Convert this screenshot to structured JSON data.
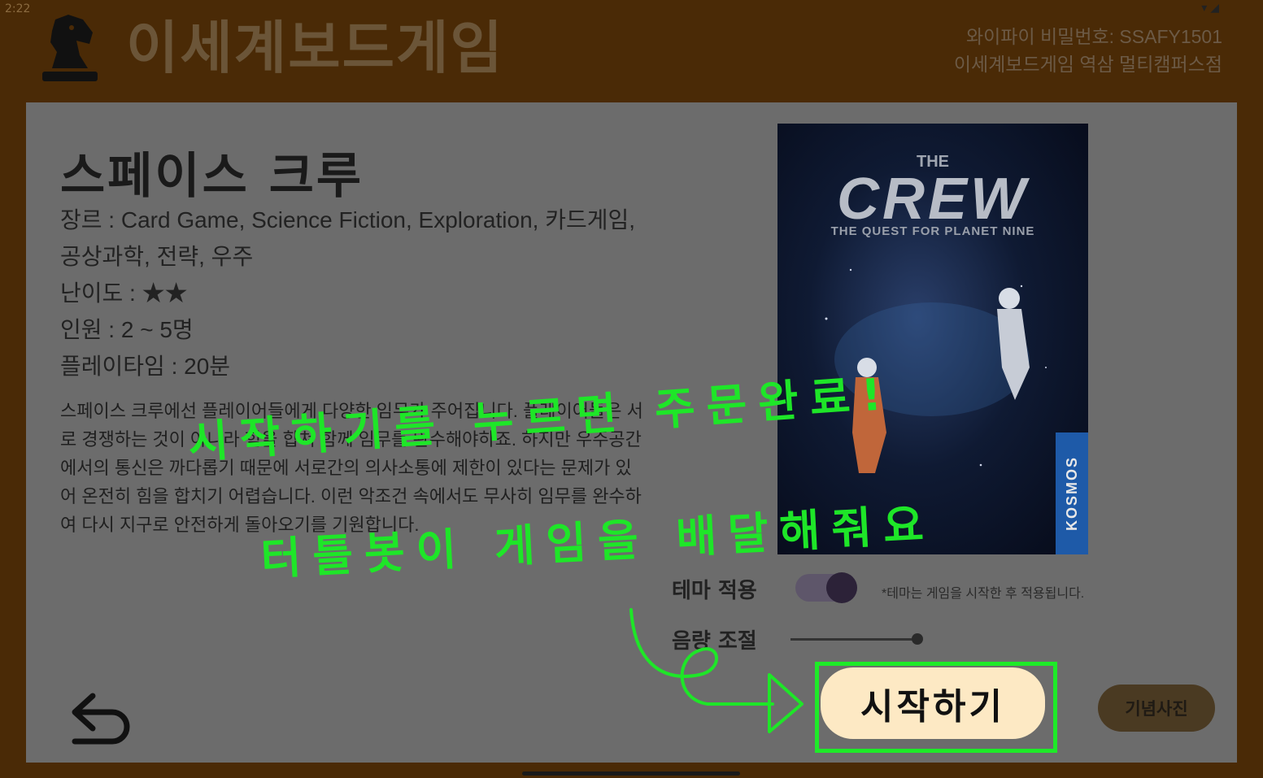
{
  "status_bar": {
    "time": "2:22"
  },
  "header": {
    "title": "이세계보드게임",
    "wifi_password": "와이파이 비밀번호: SSAFY1501",
    "store_name": "이세계보드게임 역삼 멀티캠퍼스점"
  },
  "game": {
    "title": "스페이스 크루",
    "genre": "장르 : Card Game, Science Fiction, Exploration, 카드게임, 공상과학, 전략, 우주",
    "difficulty": "난이도 : ★★",
    "players": "인원 : 2 ~ 5명",
    "playtime": "플레이타임 : 20분",
    "description": "스페이스 크루에선 플레이어들에게 다양한 임무가 주어집니다. 플레이어들은 서로 경쟁하는 것이 아니라 힘을 합쳐 함께 임무를 완수해야하죠. 하지만 우주공간에서의 통신은 까다롭기 때문에 서로간의 의사소통에 제한이 있다는 문제가 있어 온전히 힘을 합치기 어렵습니다. 이런 악조건 속에서도 무사히 임무를 완수하여 다시 지구로 안전하게 돌아오기를 기원합니다.",
    "cover": {
      "the": "THE",
      "crew": "CREW",
      "subtitle": "THE QUEST FOR PLANET NINE",
      "brand": "KOSMOS"
    }
  },
  "settings": {
    "theme_label": "테마 적용",
    "theme_note": "*테마는 게임을 시작한 후 적용됩니다.",
    "volume_label": "음량 조절",
    "volume_level": 1.0
  },
  "buttons": {
    "start": "시작하기",
    "photo": "기념사진"
  },
  "annotation": {
    "line1": "시작하기를 누르면 주문완료!",
    "line2": "터틀봇이 게임을 배달해줘요"
  },
  "colors": {
    "highlight": "#1eea28",
    "start_button": "#fde9c4",
    "header_bg": "#4a2a06"
  }
}
